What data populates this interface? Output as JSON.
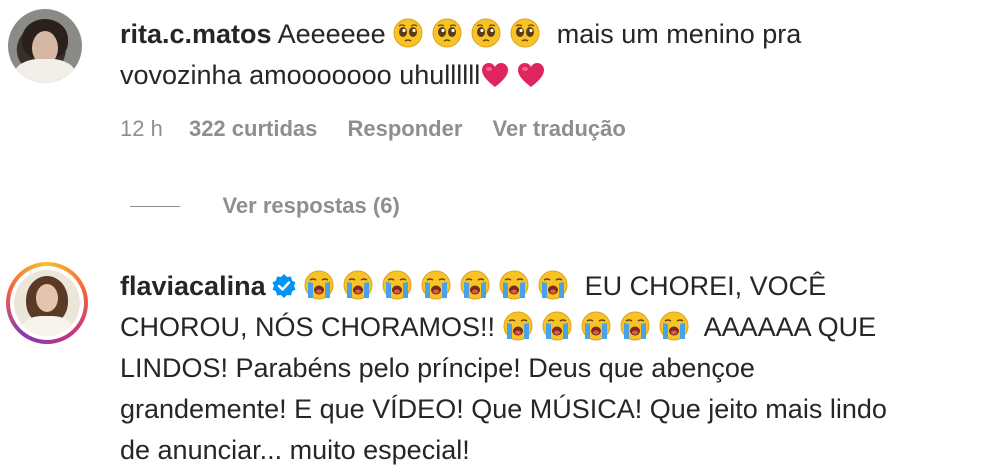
{
  "comments": [
    {
      "username": "rita.c.matos",
      "text_start": "Aeeeeee",
      "text_mid": "mais um menino pra",
      "text_line2": "vovozinha amooooooo uhullllll",
      "icons": [
        "pleading-face-emoji",
        "red-heart-emoji"
      ],
      "time": "12 h",
      "likes": "322 curtidas",
      "reply_label": "Responder",
      "translate_label": "Ver tradução",
      "view_replies": "Ver respostas (6)"
    },
    {
      "username": "flaviacalina",
      "verified": true,
      "text_line1_end": "EU CHOREI, VOCÊ",
      "text_line2_start": "CHOROU, NÓS CHORAMOS!!",
      "text_line2_end": "AAAAAA QUE",
      "text_line3": "LINDOS! Parabéns pelo príncipe! Deus que abençoe",
      "text_line4": "grandemente! E que VÍDEO! Que MÚSICA! Que jeito mais lindo",
      "text_line5": "de anunciar... muito especial!",
      "icons": [
        "verified-badge-icon",
        "loudly-crying-face-emoji"
      ]
    }
  ],
  "colors": {
    "text": "#262626",
    "secondary": "#8e8e8e",
    "verified": "#0095f6",
    "heart": "#e0245e",
    "emoji_face": "#f7c325"
  }
}
